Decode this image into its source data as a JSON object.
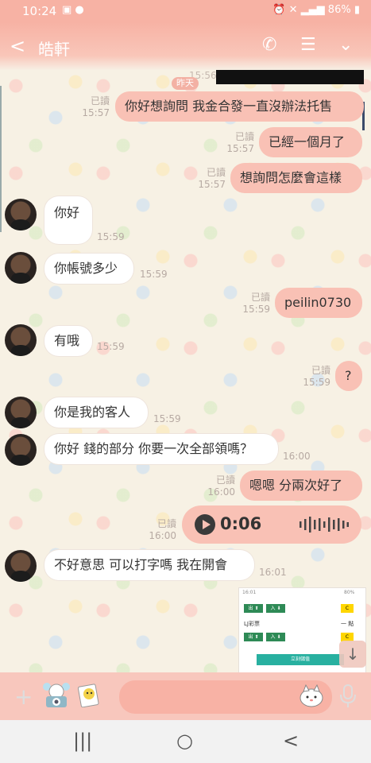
{
  "status_bar": {
    "time": "10:24",
    "battery": "86%"
  },
  "header": {
    "back_label": "<",
    "title": "皓軒"
  },
  "date_separator": "昨天",
  "date_ghost_time": "15:56",
  "messages": [
    {
      "side": "out",
      "text": "你好想詢問 我金合發一直沒辦法托售",
      "read": "已讀",
      "time": "15:57"
    },
    {
      "side": "out",
      "text": "已經一個月了",
      "read": "已讀",
      "time": "15:57"
    },
    {
      "side": "out",
      "text": "想詢問怎麼會這樣",
      "read": "已讀",
      "time": "15:57"
    },
    {
      "side": "in",
      "text": "你好",
      "time": "15:59"
    },
    {
      "side": "in",
      "text": "你帳號多少",
      "time": "15:59"
    },
    {
      "side": "out",
      "text": "peilin0730",
      "read": "已讀",
      "time": "15:59"
    },
    {
      "side": "in",
      "text": "有哦",
      "time": "15:59"
    },
    {
      "side": "out",
      "text": "?",
      "read": "已讀",
      "time": "15:59"
    },
    {
      "side": "in",
      "text": "你是我的客人",
      "time": "15:59"
    },
    {
      "side": "in",
      "text": "你好 錢的部分 你要一次全部領嗎？",
      "time": "16:00"
    },
    {
      "side": "out",
      "text": "嗯嗯 分兩次好了",
      "read": "已讀",
      "time": "16:00"
    },
    {
      "side": "out",
      "voice": true,
      "duration": "0:06",
      "read": "已讀",
      "time": "16:00"
    },
    {
      "side": "in",
      "text": "不好意思 可以打字嗎 我在開會",
      "time": "16:01"
    }
  ],
  "thumbnail": {
    "statusbar_time": "16:01",
    "statusbar_battery": "80%",
    "btn_out": "出 ⬆",
    "btn_in": "入 ⬇",
    "label_lj": "LJ彩票",
    "cta": "立刻儲值",
    "yellow_icon": "C",
    "dots_label": "一 點"
  },
  "scroll_down_label": "↓",
  "input": {
    "plus_label": "+",
    "placeholder": ""
  },
  "navbar": {
    "recent": "|||",
    "home": "○",
    "back": "<"
  },
  "colors": {
    "accent": "#f7b2a4",
    "outgoing_bubble": "#f9c1b5",
    "incoming_bubble": "#ffffff"
  }
}
